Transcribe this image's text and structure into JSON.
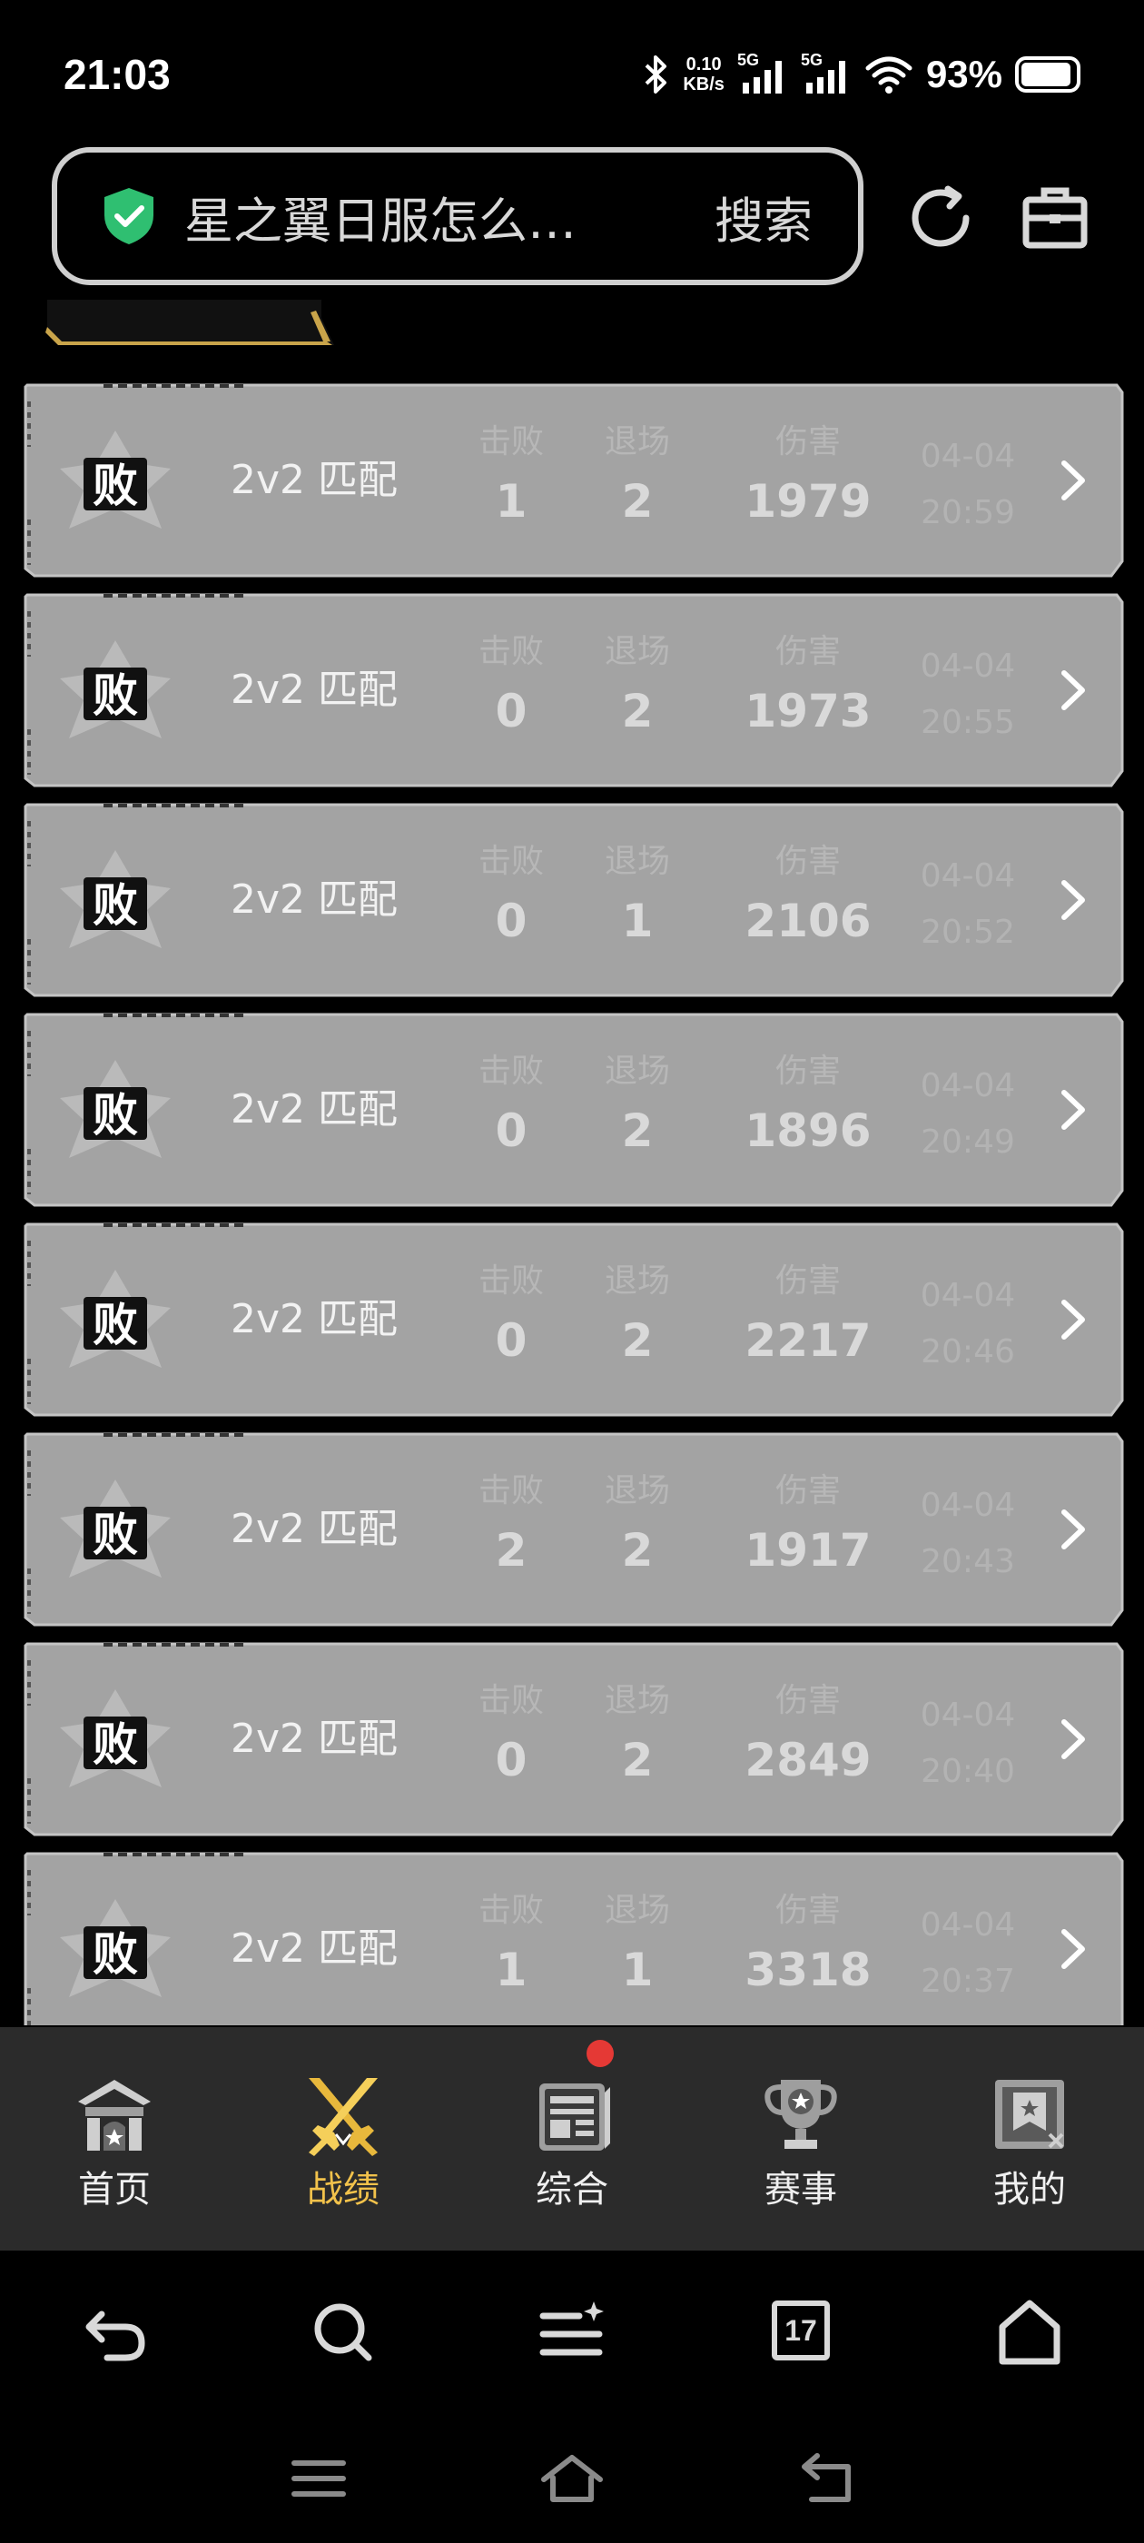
{
  "status_bar": {
    "time": "21:03",
    "net_speed_value": "0.10",
    "net_speed_unit": "KB/s",
    "sim1": "5G",
    "sim2": "5G",
    "battery": "93%"
  },
  "search": {
    "query": "星之翼日服怎么…",
    "button_label": "搜索"
  },
  "matches": [
    {
      "result": "败",
      "mode": "2v2 匹配",
      "kills_label": "击败",
      "kills": "1",
      "retreats_label": "退场",
      "retreats": "2",
      "damage_label": "伤害",
      "damage": "1979",
      "date": "04-04",
      "time": "20:59"
    },
    {
      "result": "败",
      "mode": "2v2 匹配",
      "kills_label": "击败",
      "kills": "0",
      "retreats_label": "退场",
      "retreats": "2",
      "damage_label": "伤害",
      "damage": "1973",
      "date": "04-04",
      "time": "20:55"
    },
    {
      "result": "败",
      "mode": "2v2 匹配",
      "kills_label": "击败",
      "kills": "0",
      "retreats_label": "退场",
      "retreats": "1",
      "damage_label": "伤害",
      "damage": "2106",
      "date": "04-04",
      "time": "20:52"
    },
    {
      "result": "败",
      "mode": "2v2 匹配",
      "kills_label": "击败",
      "kills": "0",
      "retreats_label": "退场",
      "retreats": "2",
      "damage_label": "伤害",
      "damage": "1896",
      "date": "04-04",
      "time": "20:49"
    },
    {
      "result": "败",
      "mode": "2v2 匹配",
      "kills_label": "击败",
      "kills": "0",
      "retreats_label": "退场",
      "retreats": "2",
      "damage_label": "伤害",
      "damage": "2217",
      "date": "04-04",
      "time": "20:46"
    },
    {
      "result": "败",
      "mode": "2v2 匹配",
      "kills_label": "击败",
      "kills": "2",
      "retreats_label": "退场",
      "retreats": "2",
      "damage_label": "伤害",
      "damage": "1917",
      "date": "04-04",
      "time": "20:43"
    },
    {
      "result": "败",
      "mode": "2v2 匹配",
      "kills_label": "击败",
      "kills": "0",
      "retreats_label": "退场",
      "retreats": "2",
      "damage_label": "伤害",
      "damage": "2849",
      "date": "04-04",
      "time": "20:40"
    },
    {
      "result": "败",
      "mode": "2v2 匹配",
      "kills_label": "击败",
      "kills": "1",
      "retreats_label": "退场",
      "retreats": "1",
      "damage_label": "伤害",
      "damage": "3318",
      "date": "04-04",
      "time": "20:37"
    }
  ],
  "tabbar": {
    "tabs": [
      {
        "label": "首页",
        "icon": "home-gate-icon",
        "active": false
      },
      {
        "label": "战绩",
        "icon": "crossed-swords-icon",
        "active": true
      },
      {
        "label": "综合",
        "icon": "newspaper-icon",
        "active": false,
        "has_badge": true
      },
      {
        "label": "赛事",
        "icon": "trophy-icon",
        "active": false
      },
      {
        "label": "我的",
        "icon": "profile-card-icon",
        "active": false
      }
    ],
    "active_color": "#f2c24b"
  },
  "browser_bar": {
    "tabs_count": "17"
  },
  "colors": {
    "card": "#a3a3a3",
    "tabbar_bg": "#2b2b2b"
  }
}
